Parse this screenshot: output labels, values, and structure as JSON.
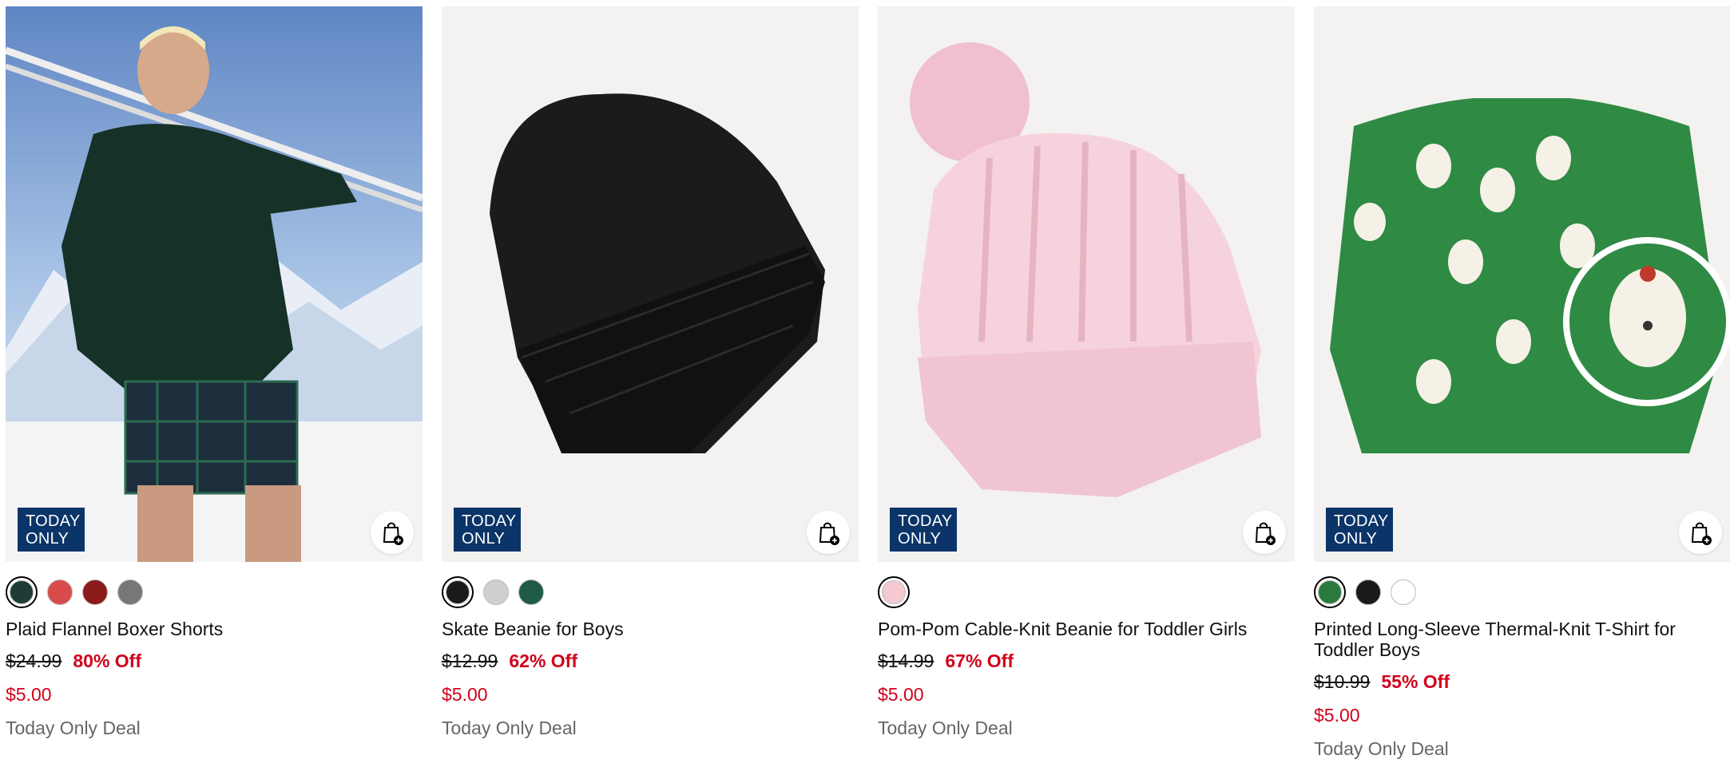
{
  "badge": {
    "line1": "TODAY",
    "line2": "ONLY"
  },
  "colors": {
    "badge_bg": "#0b3468",
    "sale_red": "#d0021b",
    "deal_gray": "#666666"
  },
  "products": [
    {
      "title": "Plaid Flannel Boxer Shorts",
      "original_price": "$24.99",
      "discount": "80% Off",
      "sale_price": "$5.00",
      "deal": "Today Only Deal",
      "image_subject": "model-in-green-hoodie-with-skis",
      "swatches": [
        "#1f3b36",
        "#d94b4b",
        "#8b1a1a",
        "#777777"
      ],
      "selected_swatch": 0
    },
    {
      "title": "Skate Beanie for Boys",
      "original_price": "$12.99",
      "discount": "62% Off",
      "sale_price": "$5.00",
      "deal": "Today Only Deal",
      "image_subject": "black-knit-beanie",
      "swatches": [
        "#1a1a1a",
        "#cfcfcf",
        "#1f5a48"
      ],
      "selected_swatch": 0
    },
    {
      "title": "Pom-Pom Cable-Knit Beanie for Toddler Girls",
      "original_price": "$14.99",
      "discount": "67% Off",
      "sale_price": "$5.00",
      "deal": "Today Only Deal",
      "image_subject": "pink-pom-pom-beanie",
      "swatches": [
        "#f3c9d2"
      ],
      "selected_swatch": 0
    },
    {
      "title": "Printed Long-Sleeve Thermal-Knit T-Shirt for Toddler Boys",
      "original_price": "$10.99",
      "discount": "55% Off",
      "sale_price": "$5.00",
      "deal": "Today Only Deal",
      "image_subject": "green-polar-bear-print-shirt",
      "swatches": [
        "#2a7a3e",
        "#1a1a1a",
        "#ffffff"
      ],
      "selected_swatch": 0
    }
  ]
}
